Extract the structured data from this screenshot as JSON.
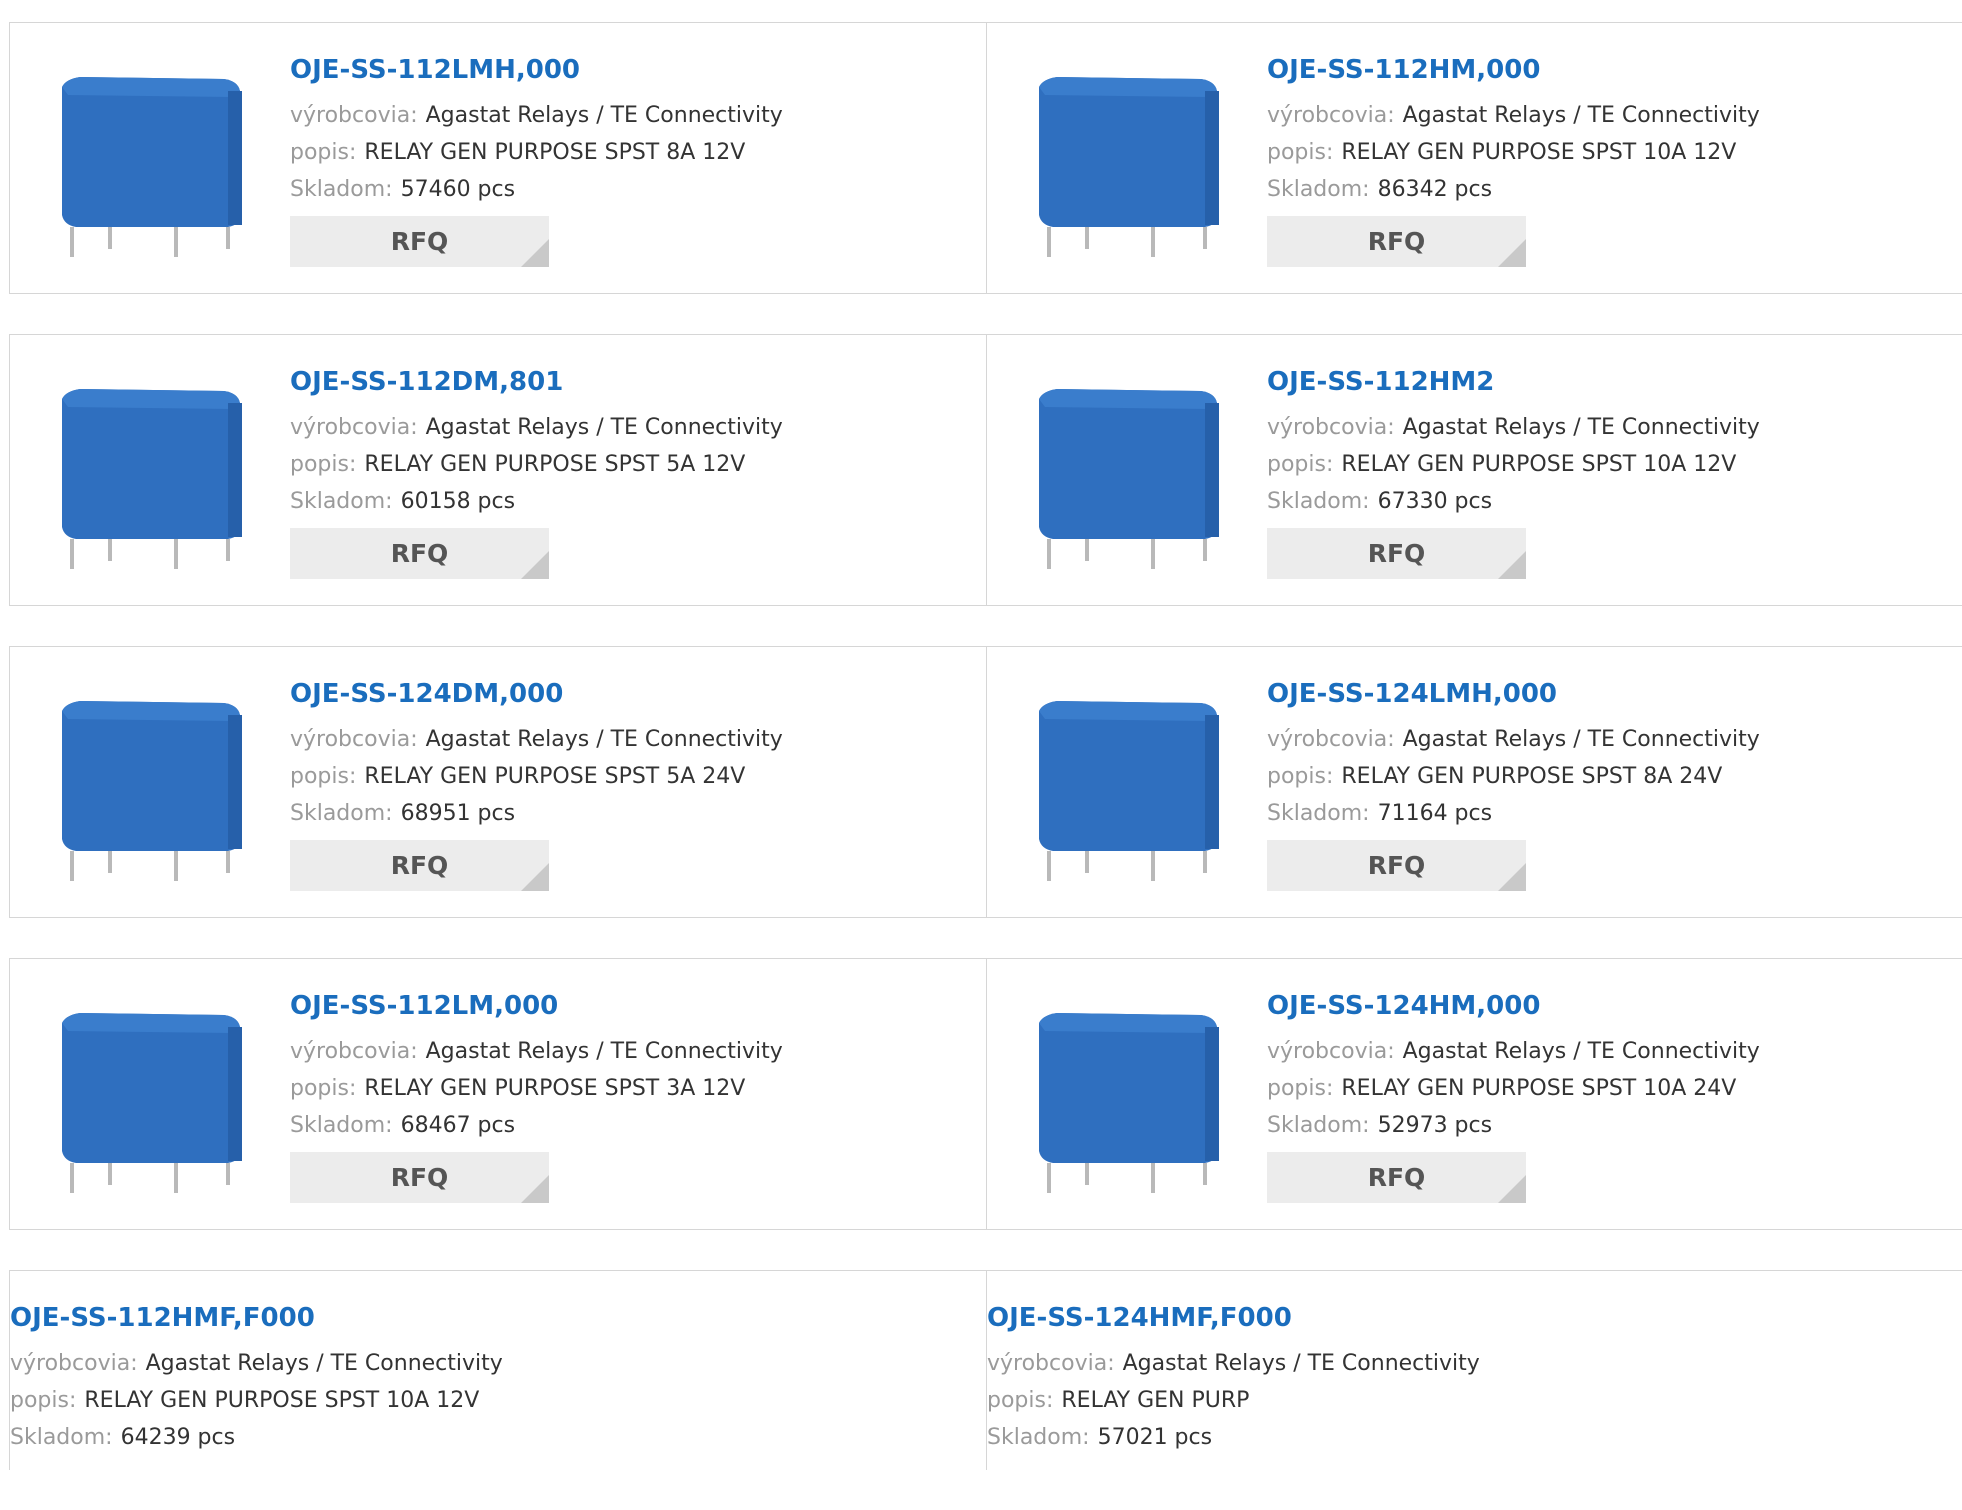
{
  "labels": {
    "manufacturer": "výrobcovia:",
    "description": "popis:",
    "stock": "Skladom:"
  },
  "rfq_label": "RFQ",
  "products": [
    {
      "name": "OJE-SS-112LMH,000",
      "manufacturer": "Agastat Relays / TE Connectivity",
      "description": "RELAY GEN PURPOSE SPST 8A 12V",
      "stock": "57460 pcs"
    },
    {
      "name": "OJE-SS-112HM,000",
      "manufacturer": "Agastat Relays / TE Connectivity",
      "description": "RELAY GEN PURPOSE SPST 10A 12V",
      "stock": "86342 pcs"
    },
    {
      "name": "OJE-SS-112DM,801",
      "manufacturer": "Agastat Relays / TE Connectivity",
      "description": "RELAY GEN PURPOSE SPST 5A 12V",
      "stock": "60158 pcs"
    },
    {
      "name": "OJE-SS-112HM2",
      "manufacturer": "Agastat Relays / TE Connectivity",
      "description": "RELAY GEN PURPOSE SPST 10A 12V",
      "stock": "67330 pcs"
    },
    {
      "name": "OJE-SS-124DM,000",
      "manufacturer": "Agastat Relays / TE Connectivity",
      "description": "RELAY GEN PURPOSE SPST 5A 24V",
      "stock": "68951 pcs"
    },
    {
      "name": "OJE-SS-124LMH,000",
      "manufacturer": "Agastat Relays / TE Connectivity",
      "description": "RELAY GEN PURPOSE SPST 8A 24V",
      "stock": "71164 pcs"
    },
    {
      "name": "OJE-SS-112LM,000",
      "manufacturer": "Agastat Relays / TE Connectivity",
      "description": "RELAY GEN PURPOSE SPST 3A 12V",
      "stock": "68467 pcs"
    },
    {
      "name": "OJE-SS-124HM,000",
      "manufacturer": "Agastat Relays / TE Connectivity",
      "description": "RELAY GEN PURPOSE SPST 10A 24V",
      "stock": "52973 pcs"
    },
    {
      "name": "OJE-SS-112HMF,F000",
      "manufacturer": "Agastat Relays / TE Connectivity",
      "description": "RELAY GEN PURPOSE SPST 10A 12V",
      "stock": "64239 pcs"
    },
    {
      "name": "OJE-SS-124HMF,F000",
      "manufacturer": "Agastat Relays / TE Connectivity",
      "description": "RELAY GEN PURP",
      "stock": "57021 pcs"
    }
  ],
  "colors": {
    "link": "#1a6dbd",
    "relay_body": "#2f6fbf",
    "rfq_bg": "#ececec"
  }
}
